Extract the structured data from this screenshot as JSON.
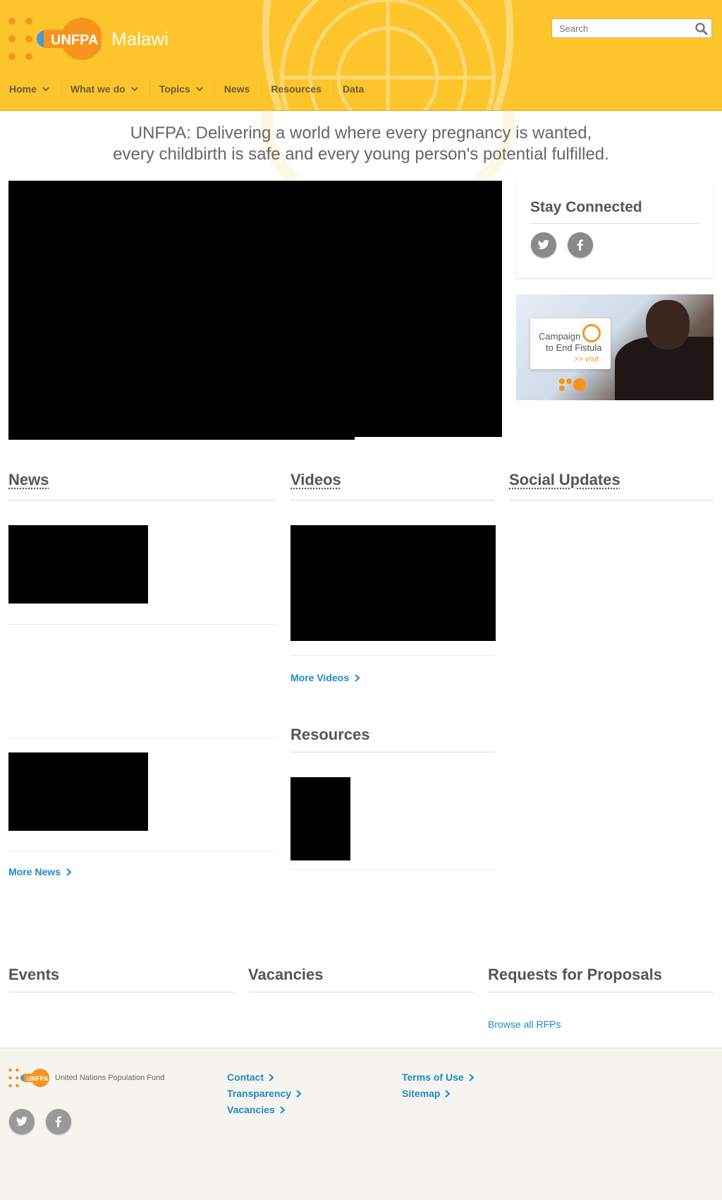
{
  "header": {
    "site_name": "Malawi",
    "logo_text": "UNFPA",
    "search_placeholder": "Search"
  },
  "nav": {
    "items": [
      {
        "label": "Home",
        "has_dropdown": true
      },
      {
        "label": "What we do",
        "has_dropdown": true
      },
      {
        "label": "Topics",
        "has_dropdown": true
      },
      {
        "label": "News",
        "has_dropdown": false
      },
      {
        "label": "Resources",
        "has_dropdown": false
      },
      {
        "label": "Data",
        "has_dropdown": false
      }
    ]
  },
  "tagline": {
    "line1": "UNFPA: Delivering a world where every pregnancy is wanted,",
    "line2": "every childbirth is safe and every young person's potential fulfilled."
  },
  "stay_connected": {
    "title": "Stay Connected",
    "icons": [
      "twitter-icon",
      "facebook-icon"
    ]
  },
  "banner": {
    "line1": "Campaign",
    "line2": "to End Fistula",
    "cta": ">> visit"
  },
  "sections": {
    "news": {
      "title": "News",
      "more": "More News"
    },
    "videos": {
      "title": "Videos",
      "more": "More Videos"
    },
    "social": {
      "title": "Social Updates"
    },
    "resources": {
      "title": "Resources"
    },
    "events": {
      "title": "Events"
    },
    "vacancies": {
      "title": "Vacancies"
    },
    "rfps": {
      "title": "Requests for Proposals",
      "link": "Browse all RFPs"
    }
  },
  "footer": {
    "logo_text": "UNFPA",
    "org_name": "United Nations Population Fund",
    "col1": [
      "Contact",
      "Transparency",
      "Vacancies"
    ],
    "col2": [
      "Terms of Use",
      "Sitemap"
    ]
  },
  "colors": {
    "header_yellow": "#fcc52c",
    "logo_orange": "#f7941d",
    "link_blue": "#1a8ac6",
    "footer_bg": "#f6f4ee"
  }
}
